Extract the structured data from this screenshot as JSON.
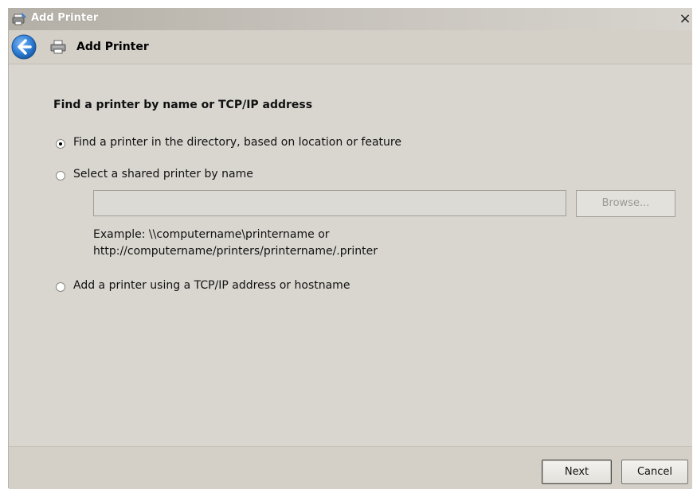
{
  "window": {
    "title": "Add Printer",
    "close_glyph": "×"
  },
  "header": {
    "title": "Add Printer",
    "back_icon": "back-arrow-icon",
    "printer_icon": "printer-icon"
  },
  "content": {
    "heading": "Find a printer by name or TCP/IP address",
    "options": [
      {
        "label": "Find a printer in the directory, based on location or feature",
        "selected": true
      },
      {
        "label": "Select a shared printer by name",
        "selected": false
      },
      {
        "label": "Add a printer using a TCP/IP address or hostname",
        "selected": false
      }
    ],
    "shared_printer_input": {
      "value": "",
      "placeholder": ""
    },
    "browse_label": "Browse...",
    "example_line1": "Example: \\\\computername\\printername or",
    "example_line2": "http://computername/printers/printername/.printer"
  },
  "footer": {
    "next_label": "Next",
    "cancel_label": "Cancel"
  },
  "colors": {
    "window_bg": "#d4d0c8",
    "content_bg": "#d9d6d0",
    "back_button_blue": "#2f7fd6"
  }
}
